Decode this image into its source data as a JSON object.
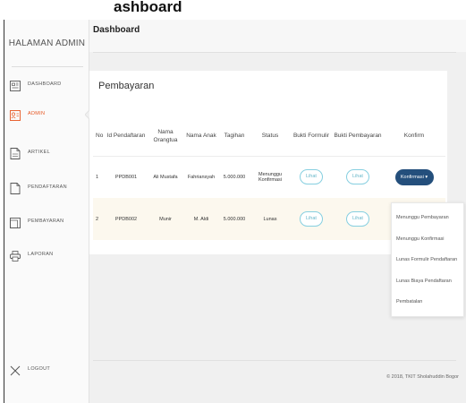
{
  "heading_fragment": "ashboard",
  "sidebar": {
    "brand": "HALAMAN ADMIN",
    "items": [
      {
        "label": "DASHBOARD",
        "icon": "dashboard-icon"
      },
      {
        "label": "ADMIN",
        "icon": "admin-icon",
        "active": true
      },
      {
        "label": "ARTIKEL",
        "icon": "document-icon"
      },
      {
        "label": "PENDAFTARAN",
        "icon": "document-icon"
      },
      {
        "label": "PEMBAYARAN",
        "icon": "payment-icon"
      },
      {
        "label": "LAPORAN",
        "icon": "printer-icon"
      }
    ],
    "logout": {
      "label": "LOGOUT",
      "icon": "close-icon"
    }
  },
  "topbar": {
    "title": "Dashboard"
  },
  "card": {
    "title": "Pembayaran",
    "columns": [
      "No",
      "Id Pendaftaran",
      "Nama Orangtua",
      "Nama Anak",
      "Tagihan",
      "Status",
      "Bukti Formulir",
      "Bukti Pembayaran",
      "Konfirm"
    ],
    "rows": [
      {
        "no": "1",
        "id": "PPDB001",
        "orangtua": "Ali Mustafa",
        "anak": "Fahriansyah",
        "tagihan": "5.000.000",
        "status": "Menunggu Konfirmasi",
        "bukti_formulir": "Lihat",
        "bukti_pembayaran": "Lihat",
        "konfirm": "Konfirmasi"
      },
      {
        "no": "2",
        "id": "PPDB002",
        "orangtua": "Munir",
        "anak": "M. Aldi",
        "tagihan": "5.000.000",
        "status": "Lunas",
        "bukti_formulir": "Lihat",
        "bukti_pembayaran": "Lihat"
      }
    ]
  },
  "dropdown": {
    "options": [
      "Menunggu Pembayaran",
      "Menunggu Konfirmasi",
      "Lunas Formulir Pendaftaran",
      "Lunas Biaya Pendaftaran",
      "Pembatalan"
    ]
  },
  "footer": {
    "text": "© 2018, TKIT Sholahuddin Bogor"
  },
  "colors": {
    "active": "#e6541f",
    "button_primary": "#244f7c",
    "button_outline": "#86cfe0",
    "highlight_row": "#fcf8ee"
  }
}
